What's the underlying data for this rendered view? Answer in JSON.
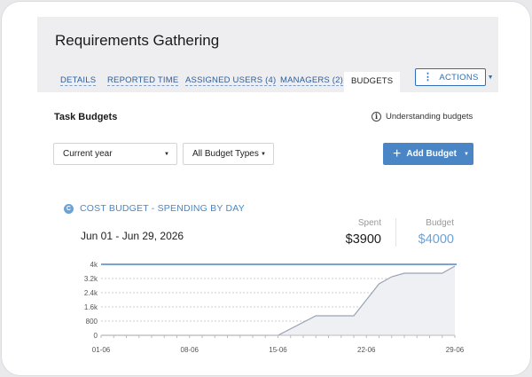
{
  "page_title": "Requirements Gathering",
  "tabs": [
    {
      "label": "DETAILS",
      "active": false
    },
    {
      "label": "REPORTED TIME",
      "active": false
    },
    {
      "label": "ASSIGNED USERS (4)",
      "active": false
    },
    {
      "label": "MANAGERS (2)",
      "active": false
    },
    {
      "label": "BUDGETS",
      "active": true
    }
  ],
  "actions": {
    "label": "ACTIONS",
    "icon": "more-vertical-icon"
  },
  "section_title": "Task Budgets",
  "understanding_link": {
    "label": "Understanding budgets",
    "icon": "info-icon"
  },
  "filters": {
    "period": {
      "value": "Current year"
    },
    "budget_type": {
      "value": "All Budget Types"
    }
  },
  "add_budget": {
    "label": "Add Budget",
    "icon": "plus-icon"
  },
  "budget_card": {
    "icon_letter": "C",
    "title": "COST BUDGET - SPENDING BY DAY",
    "date_range": "Jun 01 - Jun 29, 2026",
    "spent": {
      "label": "Spent",
      "value": "$3900"
    },
    "budget": {
      "label": "Budget",
      "value": "$4000"
    }
  },
  "colors": {
    "accent": "#4a86c5",
    "budget_value": "#6aa3d8",
    "line": "#9aa3b5",
    "area": "#eef0f4",
    "budget_line": "#4a86c5"
  },
  "chart_data": {
    "type": "area",
    "title": "",
    "xlabel": "",
    "ylabel": "",
    "x_ticks": [
      "01-06",
      "08-06",
      "15-06",
      "22-06",
      "29-06"
    ],
    "y_ticks": [
      "4k",
      "3.2k",
      "2.4k",
      "1.6k",
      "800",
      "0"
    ],
    "ylim": [
      0,
      4000
    ],
    "budget_line": 4000,
    "x": [
      1,
      15,
      18,
      21,
      23,
      24,
      25,
      28,
      29
    ],
    "values": [
      0,
      0,
      1100,
      1100,
      2900,
      3300,
      3500,
      3500,
      3900
    ],
    "grid": true
  }
}
